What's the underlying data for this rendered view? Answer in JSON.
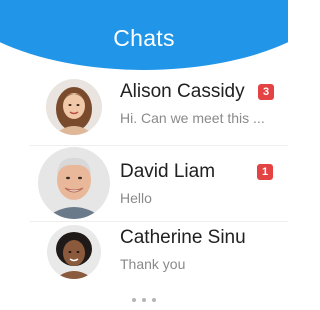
{
  "header": {
    "title": "Chats",
    "color": "#2196e9"
  },
  "chats": [
    {
      "name": "Alison Cassidy",
      "preview": "Hi. Can we meet this ...",
      "unread": "3",
      "avatar": "woman-portrait-avatar"
    },
    {
      "name": "David Liam",
      "preview": "Hello",
      "unread": "1",
      "avatar": "man-portrait-avatar"
    },
    {
      "name": "Catherine Sinu",
      "preview": "Thank you",
      "unread": "",
      "avatar": "woman-curly-hair-avatar"
    }
  ],
  "badge_color": "#e34343",
  "pager": {
    "icon": "more-dots-icon"
  }
}
